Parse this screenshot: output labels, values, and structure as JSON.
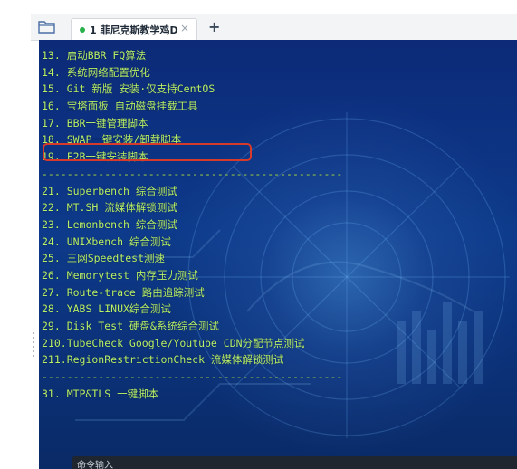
{
  "tabs": [
    {
      "label": "1 菲尼克斯教学鸡D",
      "close": "×",
      "status": "connected"
    }
  ],
  "add_tab": "+",
  "terminal": {
    "lines": [
      {
        "text": "13. 启动BBR FQ算法"
      },
      {
        "text": "14. 系统网络配置优化"
      },
      {
        "text": "15. Git 新版 安装·仅支持CentOS"
      },
      {
        "text": "16. 宝塔面板 自动磁盘挂载工具"
      },
      {
        "text": "17. BBR一键管理脚本"
      },
      {
        "text": "18. SWAP一键安装/卸载脚本"
      },
      {
        "text": "19. F2B一键安装脚本"
      },
      {
        "text": "------------------------------------------------"
      },
      {
        "text": "21. Superbench 综合测试"
      },
      {
        "text": "22. MT.SH 流媒体解锁测试"
      },
      {
        "text": "23. Lemonbench 综合测试"
      },
      {
        "text": "24. UNIXbench 综合测试"
      },
      {
        "text": "25. 三网Speedtest测速"
      },
      {
        "text": "26. Memorytest 内存压力测试"
      },
      {
        "text": "27. Route-trace 路由追踪测试"
      },
      {
        "text": "28. YABS LINUX综合测试"
      },
      {
        "text": "29. Disk Test 硬盘&系统综合测试"
      },
      {
        "text": "210.TubeCheck Google/Youtube CDN分配节点测试"
      },
      {
        "text": "211.RegionRestrictionCheck 流媒体解锁测试"
      },
      {
        "text": "------------------------------------------------"
      },
      {
        "text": "31. MTP&TLS 一键脚本"
      }
    ],
    "highlighted_line": "18. SWAP一键安装/卸载脚本",
    "command_placeholder": "命令输入"
  },
  "colors": {
    "terminal_text": "#b8f06a",
    "terminal_bg": "#0c2a78",
    "highlight_border": "#d63a2a",
    "tab_status_dot": "#28b04a"
  }
}
